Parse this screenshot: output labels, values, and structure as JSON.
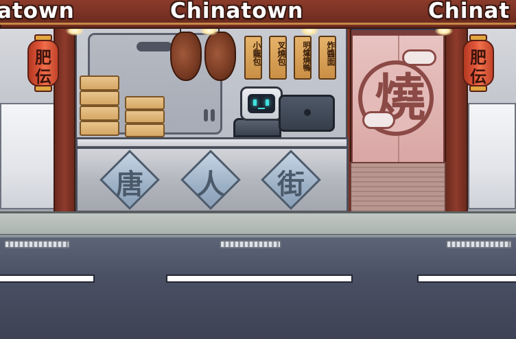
{
  "banner": {
    "left_text": "atown",
    "center_text": "Chinatown",
    "right_text": "Chinat"
  },
  "lanterns": {
    "left": [
      "肥",
      "伝"
    ],
    "right": [
      "肥",
      "伝"
    ]
  },
  "menu_signs": [
    {
      "label": "小籠包"
    },
    {
      "label": "叉燒包"
    },
    {
      "label": "明爐燒鴨"
    },
    {
      "label": "炸醬面"
    }
  ],
  "counter": {
    "characters": [
      "唐",
      "人",
      "街"
    ]
  },
  "noren": {
    "character": "燒"
  },
  "colors": {
    "banner": "#8b3b2a",
    "lantern": "#e2563a",
    "robot_eyes": "#41e3e0",
    "road": "#4a5063",
    "noren": "#d9a7a5"
  }
}
